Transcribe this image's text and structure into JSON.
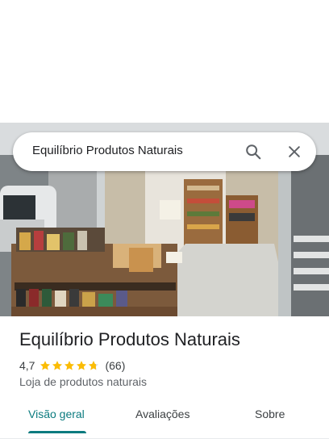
{
  "search": {
    "query": "Equilíbrio Produtos Naturais",
    "search_icon": "search-icon",
    "close_icon": "close-icon"
  },
  "place": {
    "title": "Equilíbrio Produtos Naturais",
    "rating": "4,7",
    "rating_value": 4.7,
    "reviews": "(66)",
    "category": "Loja de produtos naturais",
    "star_color": "#fbbc04"
  },
  "tabs": [
    {
      "label": "Visão geral",
      "active": true
    },
    {
      "label": "Avaliações",
      "active": false
    },
    {
      "label": "Sobre",
      "active": false
    }
  ],
  "colors": {
    "accent": "#0b7b7f"
  }
}
